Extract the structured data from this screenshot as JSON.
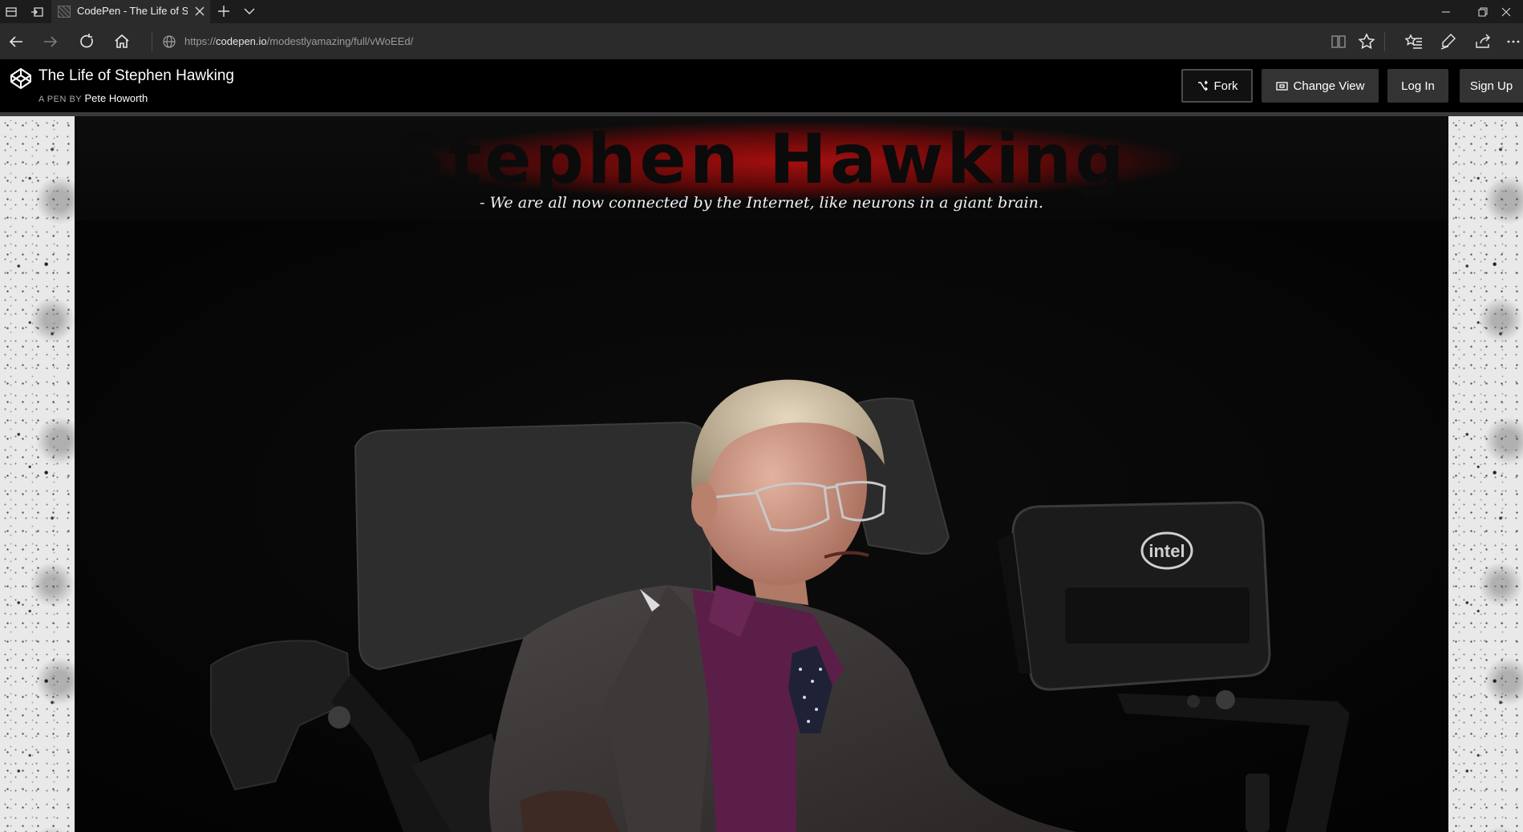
{
  "browser": {
    "tab": {
      "title": "CodePen - The Life of St"
    },
    "url": {
      "prefix": "https://",
      "domain": "codepen.io",
      "path": "/modestlyamazing/full/vWoEEd/"
    }
  },
  "codepen": {
    "title": "The Life of Stephen Hawking",
    "by_label": "A PEN BY",
    "author": "Pete Howorth",
    "buttons": {
      "fork": "Fork",
      "change_view": "Change View",
      "log_in": "Log In",
      "sign_up": "Sign Up"
    }
  },
  "hero": {
    "title": "Stephen Hawking",
    "quote": "- We are all now connected by the Internet, like neurons in a giant brain.",
    "logo_text": "intel"
  },
  "colors": {
    "accent_red": "#b00f0f",
    "shirt_purple": "#5a1e48",
    "suit_gray": "#3a3636"
  }
}
